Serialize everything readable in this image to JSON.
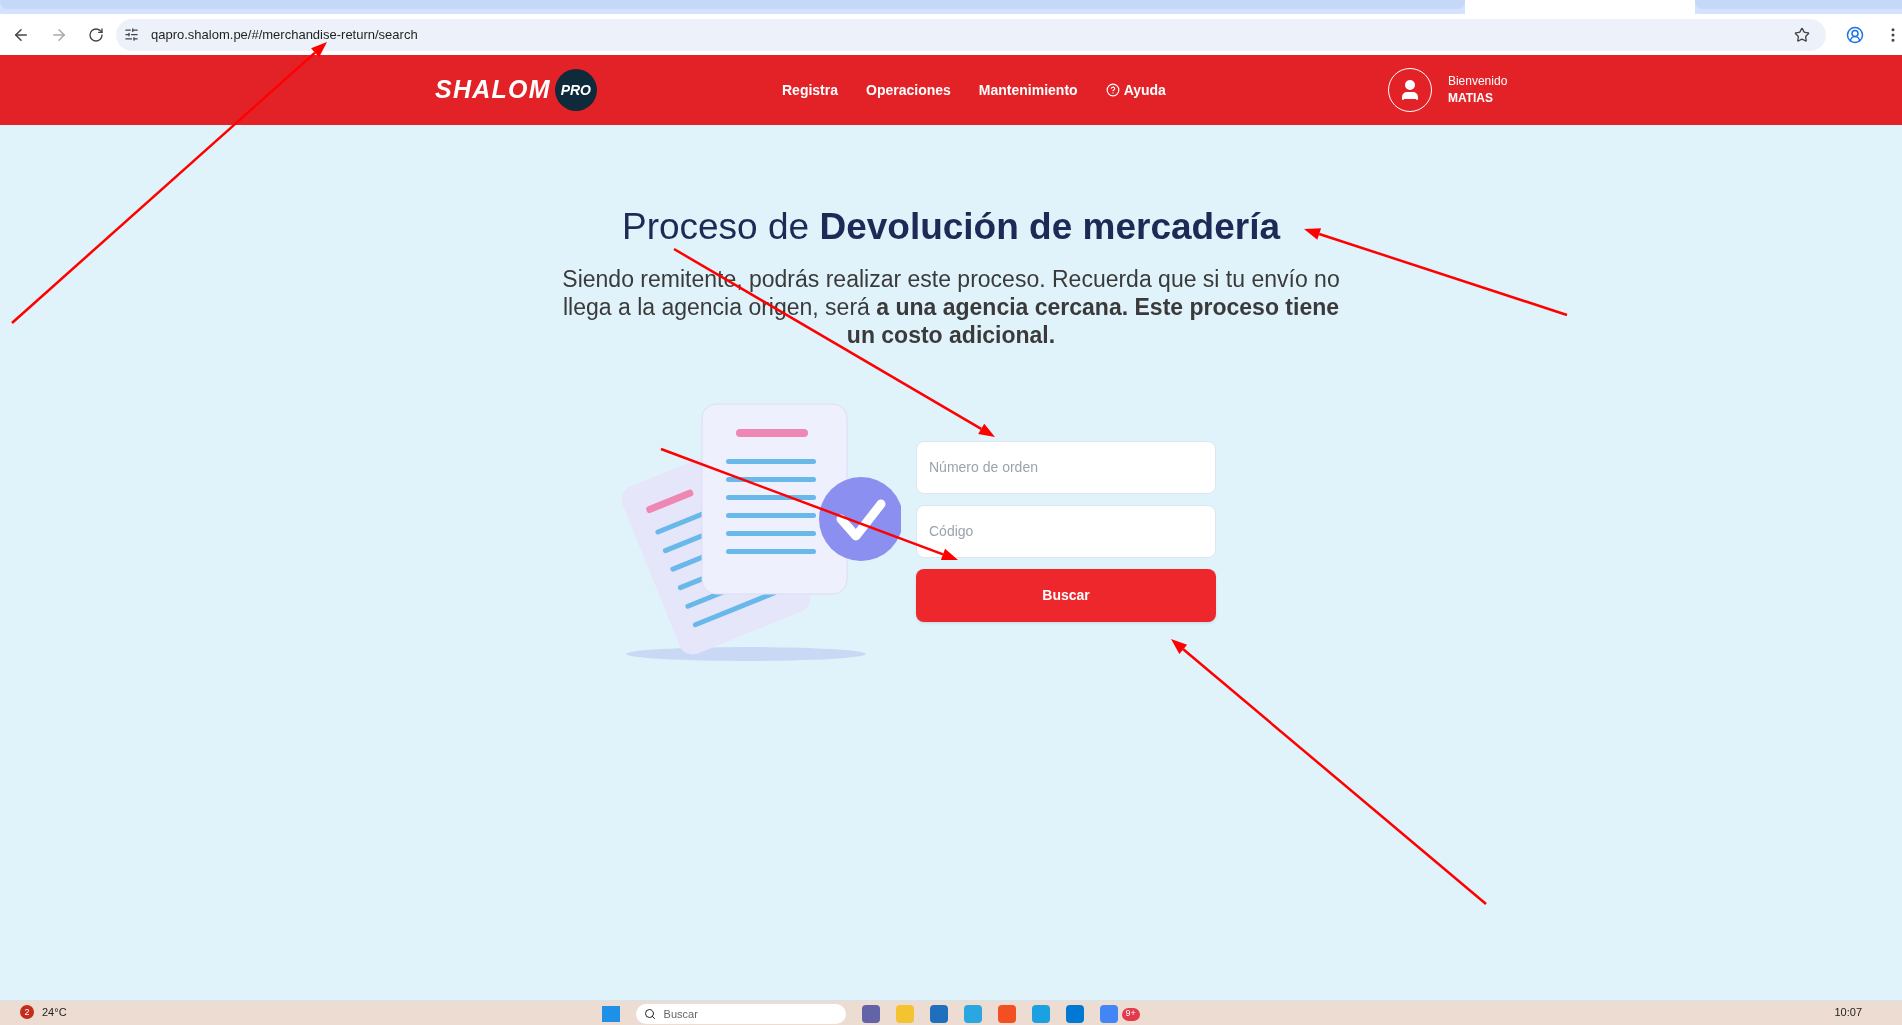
{
  "browser": {
    "url": "qapro.shalom.pe/#/merchandise-return/search"
  },
  "header": {
    "logo_text": "SHALOM",
    "logo_badge": "PRO",
    "nav": [
      {
        "label": "Registra",
        "kind": "link"
      },
      {
        "label": "Operaciones",
        "kind": "link"
      },
      {
        "label": "Mantenimiento",
        "kind": "link"
      },
      {
        "label": "Ayuda",
        "kind": "help"
      }
    ],
    "user": {
      "greeting": "Bienvenido",
      "name": "MATIAS"
    }
  },
  "page": {
    "title_plain": "Proceso de",
    "title_bold": "Devolución de mercadería",
    "description": "Siendo remitente, podrás realizar este proceso. Recuerda que si tu envío no llega a la agencia origen, será **a una agencia cercana. Este proceso tiene un costo adicional.**",
    "fields": [
      {
        "placeholder": "Número de orden"
      },
      {
        "placeholder": "Código"
      }
    ],
    "button": "Buscar"
  },
  "taskbar": {
    "weather_badge": "2",
    "temperature": "24°C",
    "search": "Buscar",
    "chat_badge": "9+",
    "time": "10:07"
  }
}
